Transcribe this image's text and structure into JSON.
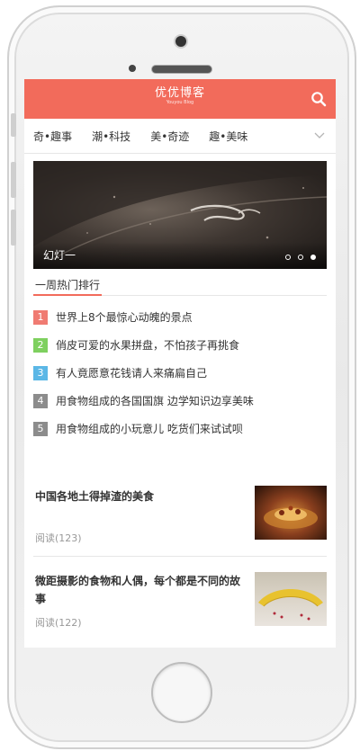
{
  "app": {
    "logo_main": "优优博客",
    "logo_sub": "Youyou Blog"
  },
  "categories": [
    "奇•趣事",
    "潮•科技",
    "美•奇迹",
    "趣•美味"
  ],
  "slider": {
    "caption": "幻灯一",
    "active_index": 2,
    "dot_count": 3
  },
  "hot": {
    "title": "一周热门排行",
    "items": [
      {
        "rank": "1",
        "text": "世界上8个最惊心动魄的景点",
        "color": "#f07b72"
      },
      {
        "rank": "2",
        "text": "俏皮可爱的水果拼盘，不怕孩子再挑食",
        "color": "#7ed05f"
      },
      {
        "rank": "3",
        "text": "有人竟愿意花钱请人来痛扁自己",
        "color": "#5bb7e6"
      },
      {
        "rank": "4",
        "text": "用食物组成的各国国旗 边学知识边享美味",
        "color": "#8c8c8c"
      },
      {
        "rank": "5",
        "text": "用食物组成的小玩意儿 吃货们来试试呗",
        "color": "#8c8c8c"
      }
    ]
  },
  "articles": [
    {
      "title": "中国各地土得掉渣的美食",
      "read": "阅读(123)"
    },
    {
      "title": "微距摄影的食物和人偶，每个都是不同的故事",
      "read": "阅读(122)"
    }
  ],
  "colors": {
    "accent": "#f26b5b"
  },
  "icons": {
    "search": "search-icon",
    "more": "chevron-down-icon"
  }
}
